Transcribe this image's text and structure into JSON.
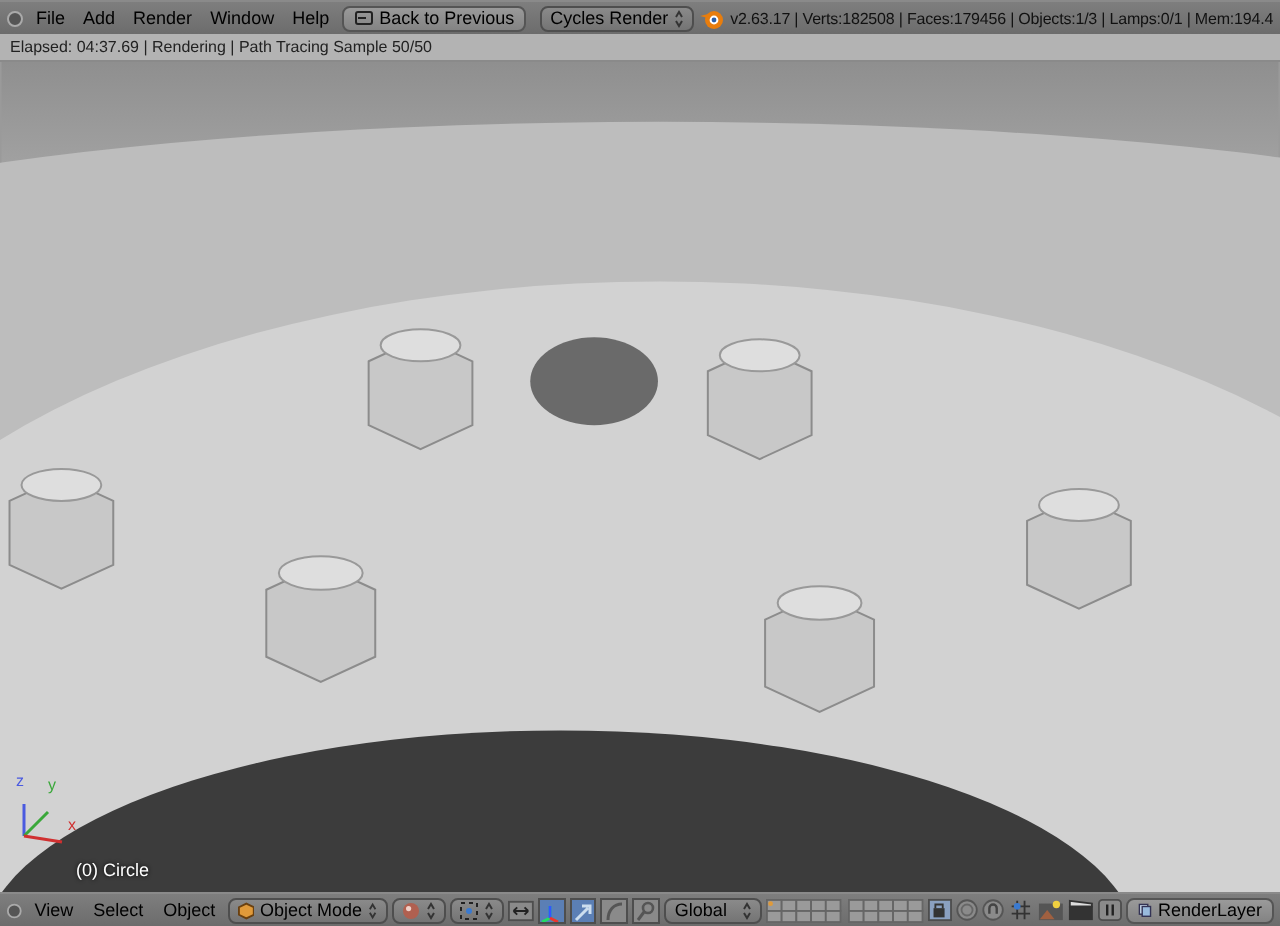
{
  "top_bar": {
    "menus": [
      "File",
      "Add",
      "Render",
      "Window",
      "Help"
    ],
    "back_button": "Back to Previous",
    "render_engine": "Cycles Render",
    "stats": "v2.63.17 | Verts:182508 | Faces:179456 | Objects:1/3 | Lamps:0/1 | Mem:194.4"
  },
  "render_status": "Elapsed: 04:37.69 | Rendering | Path Tracing Sample 50/50",
  "viewport": {
    "kind": "picture",
    "axes": [
      "z",
      "y",
      "x"
    ],
    "object_label": "(0) Circle"
  },
  "bottom_bar": {
    "menus": [
      "View",
      "Select",
      "Object"
    ],
    "mode": "Object Mode",
    "manipulators": [
      {
        "kind": "toggle",
        "selected": true
      },
      {
        "kind": "translate",
        "selected": true
      },
      {
        "kind": "rotate",
        "selected": false
      },
      {
        "kind": "scale",
        "selected": false
      }
    ],
    "orientation": "Global",
    "render_layer": "RenderLayer"
  }
}
